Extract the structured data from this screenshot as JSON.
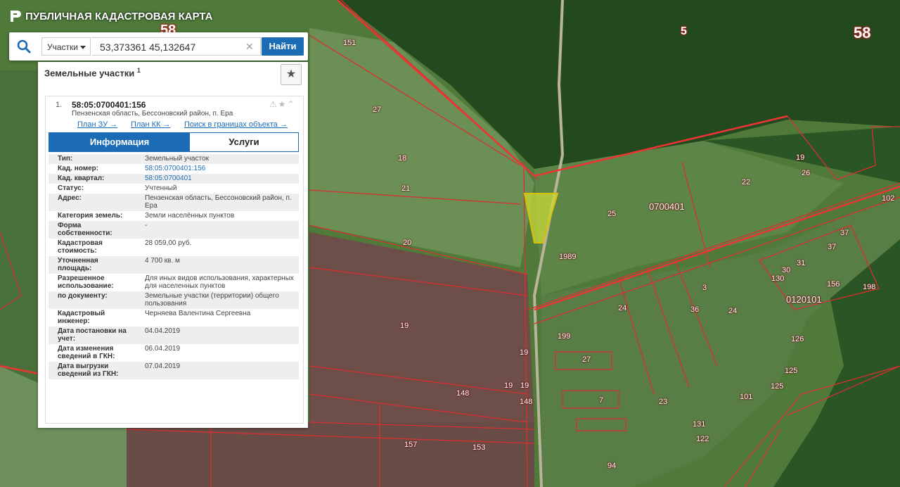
{
  "app": {
    "title": "ПУБЛИЧНАЯ КАДАСТРОВАЯ КАРТА"
  },
  "search": {
    "type_label": "Участки",
    "query": "53,373361 45,132647",
    "find_label": "Найти"
  },
  "panel": {
    "title": "Земельные участки",
    "count": "1",
    "result": {
      "index": "1.",
      "cad_number": "58:05:0700401:156",
      "address": "Пензенская область, Бессоновский район, п. Ера",
      "links": [
        "План ЗУ →",
        "План КК →",
        "Поиск в границах объекта →"
      ]
    },
    "tabs": [
      "Информация",
      "Услуги"
    ],
    "info": [
      {
        "k": "Тип:",
        "v": "Земельный участок"
      },
      {
        "k": "Кад. номер:",
        "v": "58:05:0700401:156"
      },
      {
        "k": "Кад. квартал:",
        "v": "58:05:0700401"
      },
      {
        "k": "Статус:",
        "v": "Учтенный"
      },
      {
        "k": "Адрес:",
        "v": "Пензенская область, Бессоновский район, п. Ера"
      },
      {
        "k": "Категория земель:",
        "v": "Земли населённых пунктов"
      },
      {
        "k": "Форма собственности:",
        "v": "-"
      },
      {
        "k": "Кадастровая стоимость:",
        "v": "28 059,00 руб."
      },
      {
        "k": "Уточненная площадь:",
        "v": "4 700 кв. м"
      },
      {
        "k": "Разрешенное использование:",
        "v": "Для иных видов использования, характерных для населенных пунктов"
      },
      {
        "k": "по документу:",
        "v": "Земельные участки (территории) общего пользования"
      },
      {
        "k": "Кадастровый инженер:",
        "v": "Черняева Валентина Сергеевна"
      },
      {
        "k": "Дата постановки на учет:",
        "v": "04.04.2019"
      },
      {
        "k": "Дата изменения сведений в ГКН:",
        "v": "06.04.2019"
      },
      {
        "k": "Дата выгрузки сведений из ГКН:",
        "v": "07.04.2019"
      }
    ]
  },
  "map": {
    "labels_big": [
      "58",
      "5",
      "58"
    ],
    "labels": [
      "151",
      "27",
      "18",
      "21",
      "20",
      "19",
      "19",
      "148",
      "19",
      "19",
      "148",
      "157",
      "153",
      "25",
      "1989",
      "22",
      "102",
      "199",
      "27",
      "7",
      "94",
      "122",
      "126",
      "125",
      "125",
      "24",
      "37",
      "30",
      "31",
      "198",
      "130",
      "26",
      "36",
      "24",
      "19",
      "101",
      "23",
      "131",
      "3",
      "37",
      "156"
    ],
    "quarters": [
      "0700401",
      "0120101"
    ]
  }
}
